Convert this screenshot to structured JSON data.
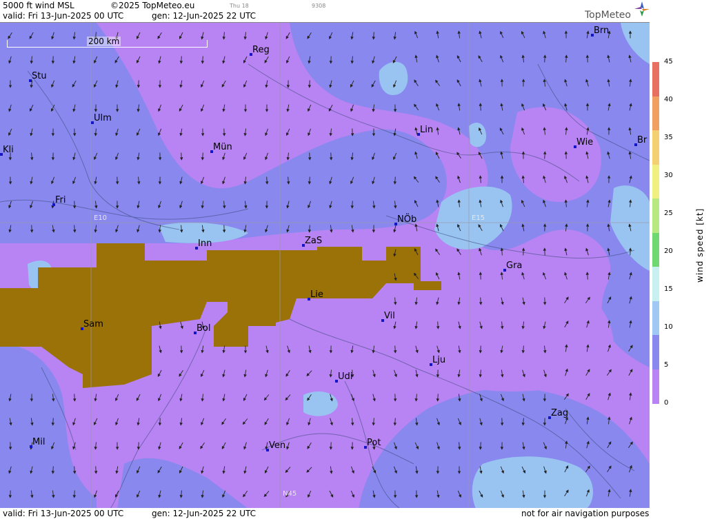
{
  "header": {
    "title": "5000 ft wind MSL",
    "copyright": "©2025 TopMeteo.eu",
    "day_tag": "Thu 18",
    "code_tag": "9308",
    "valid": "valid:  Fri  13-Jun-2025  00 UTC",
    "gen": "gen: 12-Jun-2025 22 UTC",
    "brand": "TopMeteo"
  },
  "map": {
    "scale_label": "200 km",
    "grid_labels": [
      "E10",
      "E15",
      "N45"
    ],
    "cities": [
      "Brn",
      "Reg",
      "Stu",
      "Ulm",
      "Lin",
      "Mün",
      "Wie",
      "Br",
      "Kli",
      "Fri",
      "E10",
      "NÖb",
      "Inn",
      "ZaS",
      "Gra",
      "Lie",
      "Vil",
      "Sam",
      "Bol",
      "Lju",
      "Udi",
      "Zag",
      "Mil",
      "Pot",
      "Ven"
    ],
    "colors": {
      "calm": "#b883f2",
      "light": "#8888ee",
      "moderate": "#99c4f2",
      "terrain": "#9b7208"
    }
  },
  "footer": {
    "valid": "valid:  Fri  13-Jun-2025  00 UTC",
    "gen": "gen: 12-Jun-2025 22 UTC",
    "disclaimer": "not for air navigation purposes"
  },
  "legend": {
    "title": "wind speed  [kt]",
    "ticks": [
      "45",
      "40",
      "35",
      "30",
      "25",
      "20",
      "15",
      "10",
      "5",
      "0"
    ],
    "colors": [
      "#e87060",
      "#f0a060",
      "#f4d070",
      "#f0f080",
      "#b8e880",
      "#70d870",
      "#c8f0f0",
      "#a0c8f4",
      "#8888ee",
      "#b883f2"
    ]
  }
}
